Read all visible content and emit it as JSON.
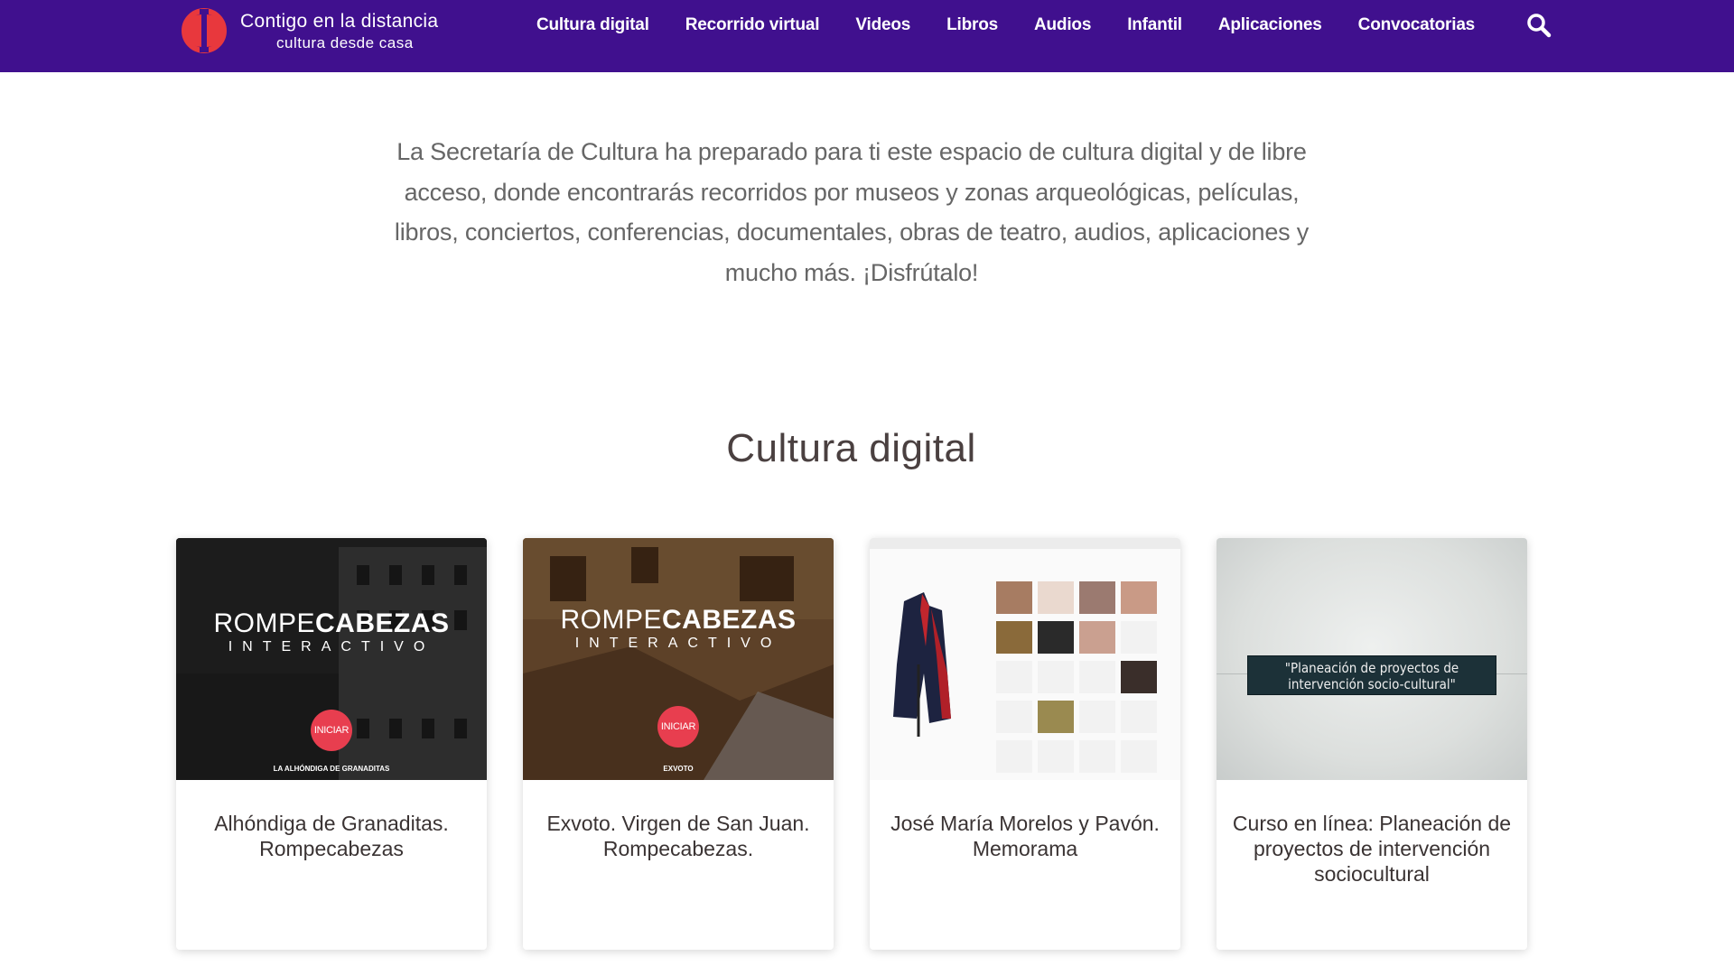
{
  "brand": {
    "line1": "Contigo en la distancia",
    "line2": "cultura desde casa",
    "color_primary": "#40108e",
    "color_logo": "#e8383d"
  },
  "nav": {
    "items": [
      {
        "label": "Cultura digital"
      },
      {
        "label": "Recorrido virtual"
      },
      {
        "label": "Videos"
      },
      {
        "label": "Libros"
      },
      {
        "label": "Audios"
      },
      {
        "label": "Infantil"
      },
      {
        "label": "Aplicaciones"
      },
      {
        "label": "Convocatorias"
      }
    ],
    "search_icon": "search-icon"
  },
  "intro": {
    "text": "La Secretaría de Cultura ha preparado para ti este espacio de cultura digital y de libre acceso, donde encontrarás recorridos por museos y zonas arqueológicas, películas, libros, conciertos, conferencias, documentales, obras de teatro, audios, aplicaciones y mucho más. ¡Disfrútalo!"
  },
  "section": {
    "title": "Cultura digital"
  },
  "cards": [
    {
      "title": "Alhóndiga de Granaditas. Rompecabezas",
      "thumb": {
        "word_light": "ROMPE",
        "word_bold": "CABEZAS",
        "sub": "INTERACTIVO",
        "button": "INICIAR",
        "caption": "LA ALHÓNDIGA DE GRANADITAS"
      }
    },
    {
      "title": "Exvoto. Virgen de San Juan. Rompecabezas.",
      "thumb": {
        "word_light": "ROMPE",
        "word_bold": "CABEZAS",
        "sub": "INTERACTIVO",
        "button": "INICIAR",
        "caption": "EXVOTO"
      }
    },
    {
      "title": "José María Morelos y Pavón. Memorama"
    },
    {
      "title": "Curso en línea: Planeación de proyectos de intervención sociocultural",
      "thumb": {
        "banner": "\"Planeación de proyectos de intervención socio-cultural\""
      }
    }
  ]
}
